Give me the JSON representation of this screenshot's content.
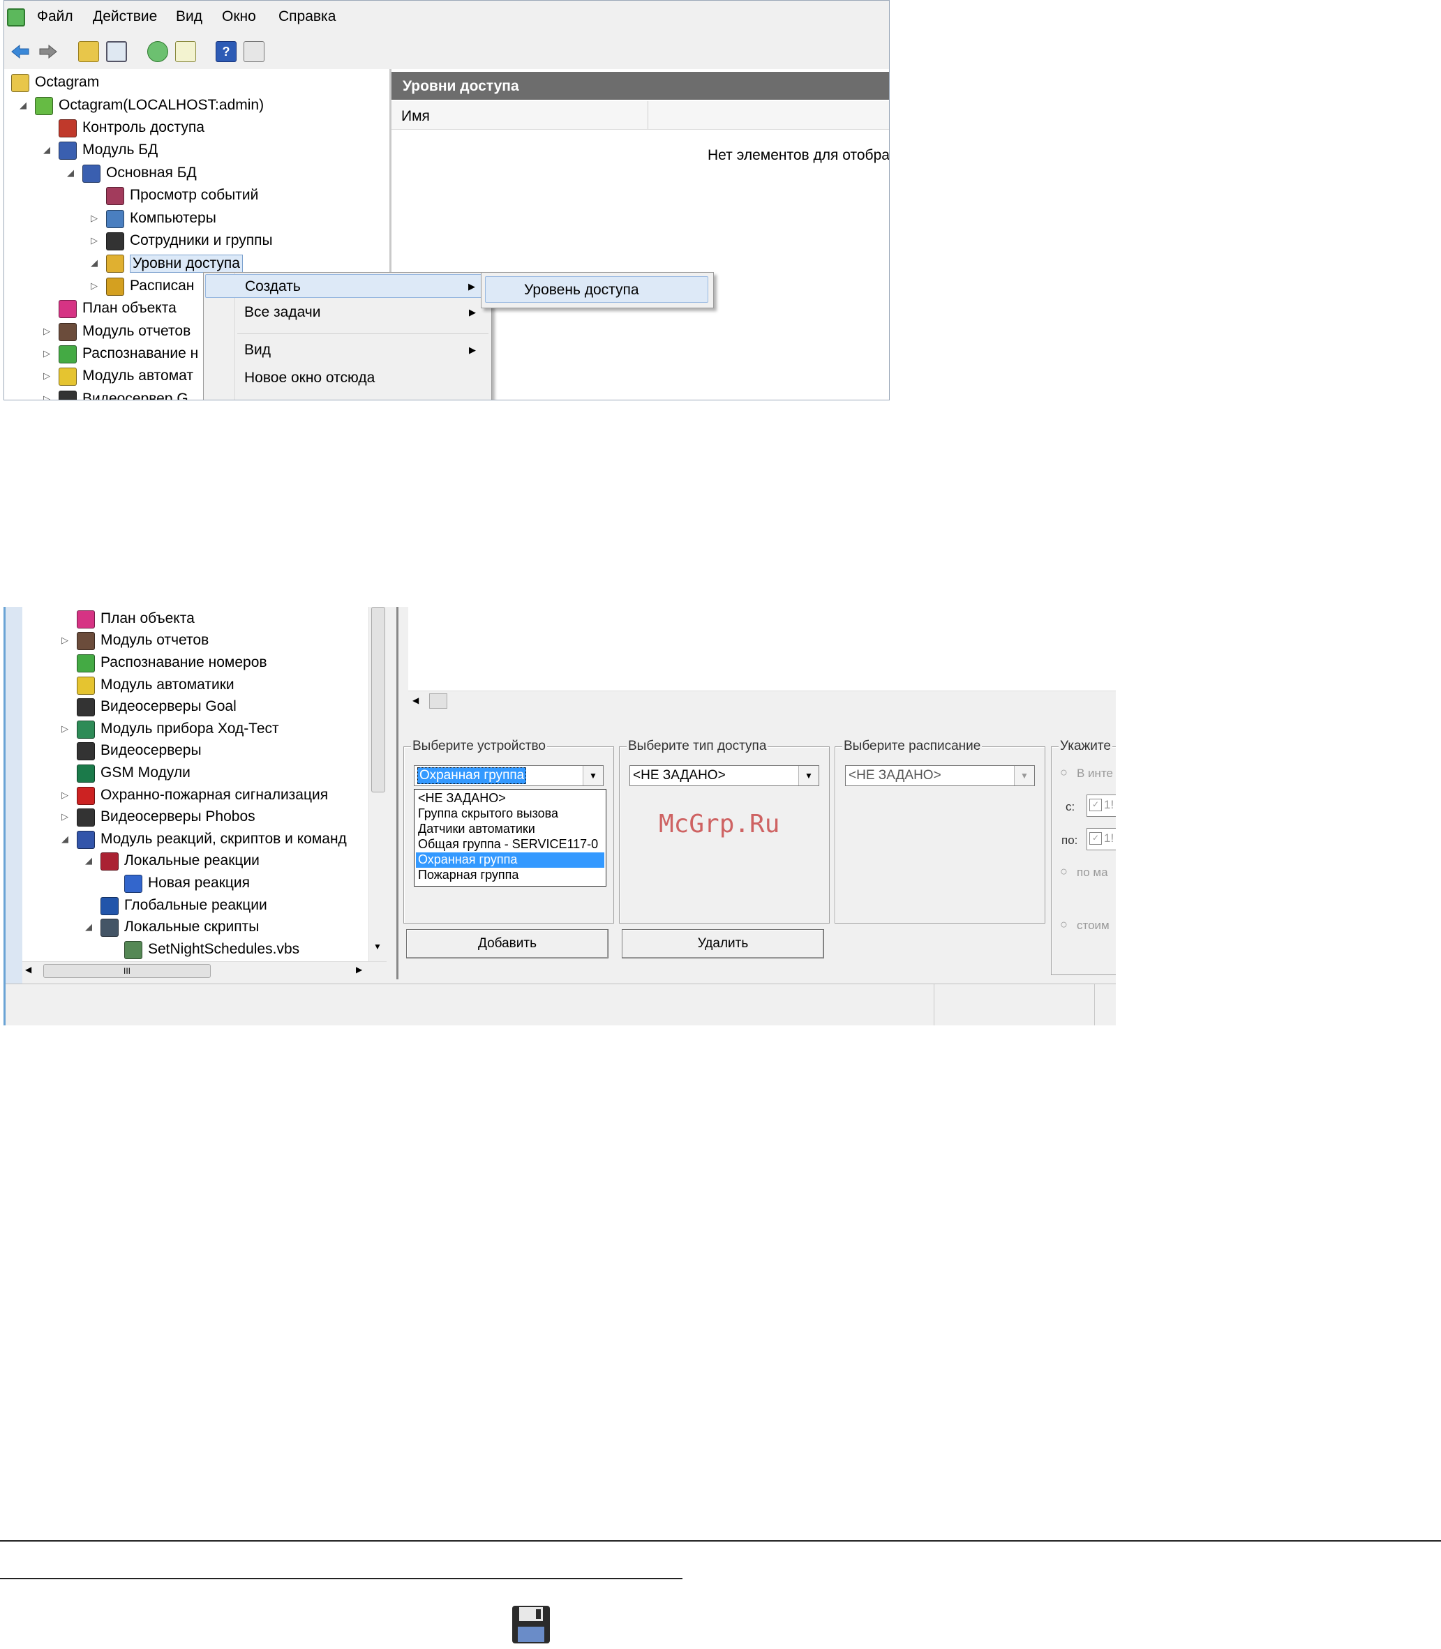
{
  "screen1": {
    "menu": [
      "Файл",
      "Действие",
      "Вид",
      "Окно",
      "Справка"
    ],
    "tree": [
      {
        "label": "Octagram",
        "icon": "folder-icon",
        "expander": "",
        "color": "#e8c64a"
      },
      {
        "label": "Octagram(LOCALHOST:admin)",
        "icon": "gear-server-icon",
        "expander": "◢",
        "color": "#66bb44"
      },
      {
        "label": "Контроль доступа",
        "icon": "lock-icon",
        "expander": "",
        "color": "#c0392b"
      },
      {
        "label": "Модуль БД",
        "icon": "database-icon",
        "expander": "◢",
        "color": "#3a5fb0"
      },
      {
        "label": "Основная БД",
        "icon": "database-icon",
        "expander": "◢",
        "color": "#3a5fb0"
      },
      {
        "label": "Просмотр событий",
        "icon": "event-log-icon",
        "expander": "",
        "color": "#a23b5c"
      },
      {
        "label": "Компьютеры",
        "icon": "computers-icon",
        "expander": "▷",
        "color": "#4a7fc0"
      },
      {
        "label": "Сотрудники и группы",
        "icon": "users-icon",
        "expander": "▷",
        "color": "#333333"
      },
      {
        "label": "Уровни доступа",
        "icon": "access-levels-icon",
        "expander": "◢",
        "color": "#e0b030"
      },
      {
        "label": "Расписан",
        "icon": "schedule-icon",
        "expander": "▷",
        "color": "#d4a020"
      },
      {
        "label": "План объекта",
        "icon": "floor-plan-icon",
        "expander": "",
        "color": "#d63384"
      },
      {
        "label": "Модуль отчетов",
        "icon": "reports-icon",
        "expander": "▷",
        "color": "#6b4c3b"
      },
      {
        "label": "Распознавание н",
        "icon": "plate-recognition-icon",
        "expander": "▷",
        "color": "#44aa44"
      },
      {
        "label": "Модуль автомат",
        "icon": "automation-icon",
        "expander": "▷",
        "color": "#e5c430"
      },
      {
        "label": "Видеосервер G",
        "icon": "camera-icon",
        "expander": "▷",
        "color": "#333333"
      }
    ],
    "right_title": "Уровни доступа",
    "column_name": "Имя",
    "empty_message": "Нет элементов для отобра",
    "context_menu": [
      {
        "label": "Создать",
        "has_submenu": true
      },
      {
        "label": "Все задачи",
        "has_submenu": true
      },
      {
        "label": "Вид",
        "has_submenu": true
      },
      {
        "label": "Новое окно отсюда",
        "has_submenu": false
      }
    ],
    "submenu": [
      "Уровень доступа"
    ]
  },
  "screen2": {
    "tree": [
      {
        "label": "План объекта",
        "icon": "floor-plan-icon",
        "expander": "",
        "color": "#d63384"
      },
      {
        "label": "Модуль отчетов",
        "icon": "reports-icon",
        "expander": "▷",
        "color": "#6b4c3b"
      },
      {
        "label": "Распознавание номеров",
        "icon": "plate-recognition-icon",
        "expander": "",
        "color": "#44aa44"
      },
      {
        "label": "Модуль автоматики",
        "icon": "automation-icon",
        "expander": "",
        "color": "#e5c430"
      },
      {
        "label": "Видеосерверы Goal",
        "icon": "camera-icon",
        "expander": "",
        "color": "#333333"
      },
      {
        "label": "Модуль прибора Ход-Тест",
        "icon": "test-device-icon",
        "expander": "▷",
        "color": "#2e8b57"
      },
      {
        "label": "Видеосерверы",
        "icon": "camera-icon",
        "expander": "",
        "color": "#333333"
      },
      {
        "label": "GSM Модули",
        "icon": "gsm-phone-icon",
        "expander": "",
        "color": "#1b7a4a"
      },
      {
        "label": "Охранно-пожарная сигнализация",
        "icon": "fire-alarm-icon",
        "expander": "▷",
        "color": "#cc2222"
      },
      {
        "label": "Видеосерверы Phobos",
        "icon": "camera-icon",
        "expander": "▷",
        "color": "#333333"
      },
      {
        "label": "Модуль реакций, скриптов и команд",
        "icon": "reactions-module-icon",
        "expander": "◢",
        "color": "#3355aa"
      },
      {
        "label": "Локальные реакции",
        "icon": "local-reactions-icon",
        "expander": "◢",
        "color": "#aa2233"
      },
      {
        "label": "Новая реакция",
        "icon": "pen-icon",
        "expander": "",
        "color": "#3366cc"
      },
      {
        "label": "Глобальные реакции",
        "icon": "global-reactions-icon",
        "expander": "",
        "color": "#2255aa"
      },
      {
        "label": "Локальные скрипты",
        "icon": "local-scripts-icon",
        "expander": "◢",
        "color": "#445566"
      },
      {
        "label": "SetNightSchedules.vbs",
        "icon": "script-icon",
        "expander": "",
        "color": "#558855"
      }
    ],
    "hscroll_grip": "III",
    "device_group_title": "Выберите устройство",
    "device_selected": "Охранная группа",
    "device_options": [
      "<НЕ ЗАДАНО>",
      "Группа скрытого вызова",
      "Датчики автоматики",
      "Общая группа - SERVICE117-0",
      "Охранная группа",
      "Пожарная группа"
    ],
    "device_highlight_index": 4,
    "access_type_title": "Выберите тип доступа",
    "access_type_value": "<НЕ ЗАДАНО>",
    "schedule_title": "Выберите расписание",
    "schedule_value": "<НЕ ЗАДАНО>",
    "specify_title": "Укажите",
    "radio_interval": "В инте",
    "from_label": "с:",
    "to_label": "по:",
    "date_fragment": "1!",
    "radio_max": "по ма",
    "radio_cost": "стоим",
    "add_button": "Добавить",
    "delete_button": "Удалить",
    "watermark": "McGrp.Ru"
  }
}
